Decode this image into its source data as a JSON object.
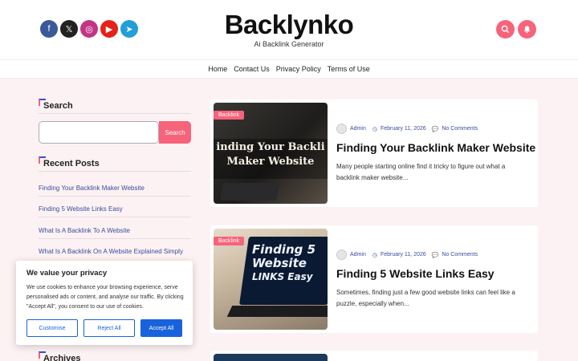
{
  "header": {
    "title": "Backlynko",
    "subtitle": "Ai Backlink Generator",
    "social": [
      {
        "name": "facebook-icon",
        "glyph": "f",
        "color": "#3b5998"
      },
      {
        "name": "x-icon",
        "glyph": "𝕏",
        "color": "#222222"
      },
      {
        "name": "instagram-icon",
        "glyph": "◎",
        "color": "#c13584"
      },
      {
        "name": "youtube-icon",
        "glyph": "▶",
        "color": "#e62117"
      },
      {
        "name": "telegram-icon",
        "glyph": "➤",
        "color": "#229ed9"
      }
    ]
  },
  "nav": [
    "Home",
    "Contact Us",
    "Privacy Policy",
    "Terms of Use"
  ],
  "sidebar": {
    "search_title": "Search",
    "search_button": "Search",
    "recent_title": "Recent Posts",
    "recent_posts": [
      "Finding Your Backlink Maker Website",
      "Finding 5 Website Links Easy",
      "What Is A Backlink To A Website",
      "What Is A Backlink On A Website Explained Simply"
    ],
    "archives_title": "Archives"
  },
  "posts": [
    {
      "category": "Backlink",
      "author": "Admin",
      "date": "February 11, 2026",
      "comments": "No Comments",
      "title": "Finding Your Backlink Maker Website",
      "excerpt": "Many people starting online find it tricky to figure out what a backlink maker website...",
      "image_text_1": "inding Your Backli",
      "image_text_2": "Maker Website"
    },
    {
      "category": "Backlink",
      "author": "Admin",
      "date": "February 11, 2026",
      "comments": "No Comments",
      "title": "Finding 5 Website Links Easy",
      "excerpt": "Sometimes, finding just a few good website links can feel like a puzzle, especially when...",
      "image_text_1": "Finding 5",
      "image_text_2": "Website",
      "image_text_3": "LINKS Easy"
    }
  ],
  "cookie": {
    "title": "We value your privacy",
    "text": "We use cookies to enhance your browsing experience, serve personalised ads or content, and analyse our traffic. By clicking \"Accept All\", you consent to our use of cookies.",
    "customise": "Customise",
    "reject": "Reject All",
    "accept": "Accept All"
  },
  "colors": {
    "accent": "#f7637a",
    "blue": "#3a4ed5",
    "link": "#3a4a9d",
    "background": "#fdf2f3"
  }
}
